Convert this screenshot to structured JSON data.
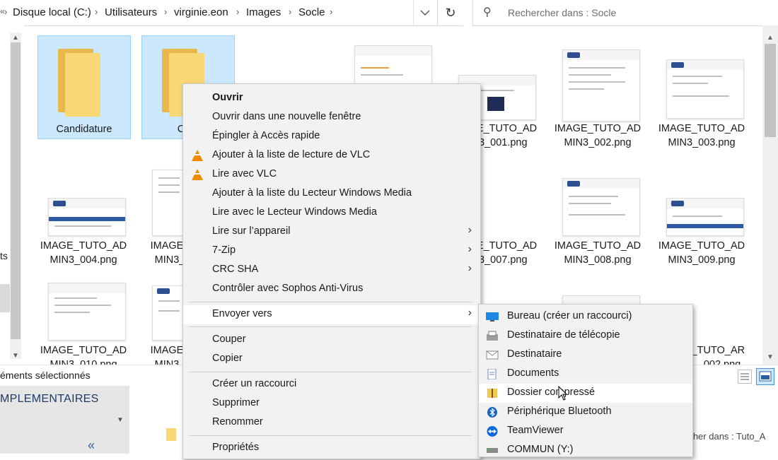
{
  "address": {
    "breadcrumb": [
      "Disque local (C:)",
      "Utilisateurs",
      "virginie.eon",
      "Images",
      "Socle"
    ],
    "search_placeholder": "Rechercher dans : Socle"
  },
  "files": [
    {
      "name1": "Candidature",
      "name2": "",
      "kind": "folder",
      "selected": true
    },
    {
      "name1": "C",
      "name2": "",
      "kind": "folder",
      "selected": true
    },
    {
      "name1": "IMAGE_TUTO_AD",
      "name2": "MIN3_001.png",
      "kind": "image"
    },
    {
      "name1": "IMAGE_TUTO_AD",
      "name2": "MIN3_002.png",
      "kind": "image"
    },
    {
      "name1": "IMAGE_TUTO_AD",
      "name2": "MIN3_003.png",
      "kind": "image"
    },
    {
      "name1": "IMAGE_TUTO_AD",
      "name2": "MIN3_004.png",
      "kind": "image"
    },
    {
      "name1": "IMAGE_",
      "name2": "MIN3_",
      "kind": "image"
    },
    {
      "name1": "IMAGE_TUTO_AD",
      "name2": "MIN3_007.png",
      "kind": "image"
    },
    {
      "name1": "IMAGE_TUTO_AD",
      "name2": "MIN3_008.png",
      "kind": "image"
    },
    {
      "name1": "IMAGE_TUTO_AD",
      "name2": "MIN3_009.png",
      "kind": "image"
    },
    {
      "name1": "IMAGE_TUTO_AD",
      "name2": "MIN3_010.png",
      "kind": "image"
    },
    {
      "name1": "IMAGE_",
      "name2": "MIN3_",
      "kind": "image"
    },
    {
      "name1": "IMAGE_TUTO_AR",
      "name2": "_002.png",
      "kind": "image"
    }
  ],
  "left_edge": {
    "text1": "ts",
    "text2": ":)"
  },
  "status": {
    "selection": "éments sélectionnés"
  },
  "context_menu": [
    {
      "label": "Ouvrir",
      "bold": true
    },
    {
      "label": "Ouvrir dans une nouvelle fenêtre"
    },
    {
      "label": "Épingler à Accès rapide"
    },
    {
      "label": "Ajouter à la liste de lecture de VLC",
      "icon": "vlc-icon"
    },
    {
      "label": "Lire avec VLC",
      "icon": "vlc-icon"
    },
    {
      "label": "Ajouter à la liste du Lecteur Windows Media"
    },
    {
      "label": "Lire avec le Lecteur Windows Media"
    },
    {
      "label": "Lire sur l’appareil",
      "submenu": true
    },
    {
      "label": "7-Zip",
      "submenu": true
    },
    {
      "label": "CRC SHA",
      "submenu": true
    },
    {
      "label": "Contrôler avec Sophos Anti-Virus"
    },
    {
      "label": "Envoyer vers",
      "submenu": true,
      "highlighted": true
    },
    {
      "label": "Couper"
    },
    {
      "label": "Copier"
    },
    {
      "label": "Créer un raccourci"
    },
    {
      "label": "Supprimer"
    },
    {
      "label": "Renommer"
    },
    {
      "label": "Propriétés"
    }
  ],
  "send_to_menu": [
    {
      "label": "Bureau (créer un raccourci)",
      "icon": "desktop-icon"
    },
    {
      "label": "Destinataire de télécopie",
      "icon": "fax-icon"
    },
    {
      "label": "Destinataire",
      "icon": "mail-icon"
    },
    {
      "label": "Documents",
      "icon": "documents-icon"
    },
    {
      "label": "Dossier compressé",
      "icon": "zip-folder-icon",
      "highlighted": true
    },
    {
      "label": "Périphérique Bluetooth",
      "icon": "bluetooth-icon"
    },
    {
      "label": "TeamViewer",
      "icon": "teamviewer-icon"
    },
    {
      "label": "COMMUN (Y:)",
      "icon": "network-drive-icon"
    }
  ],
  "background_window": {
    "sidebar_caption": "MPLEMENTAIRES",
    "search_placeholder": "rcher dans : Tuto_A"
  },
  "colors": {
    "selection": "#cce8ff",
    "accent": "#0078d7",
    "vlc": "#f08a00"
  }
}
